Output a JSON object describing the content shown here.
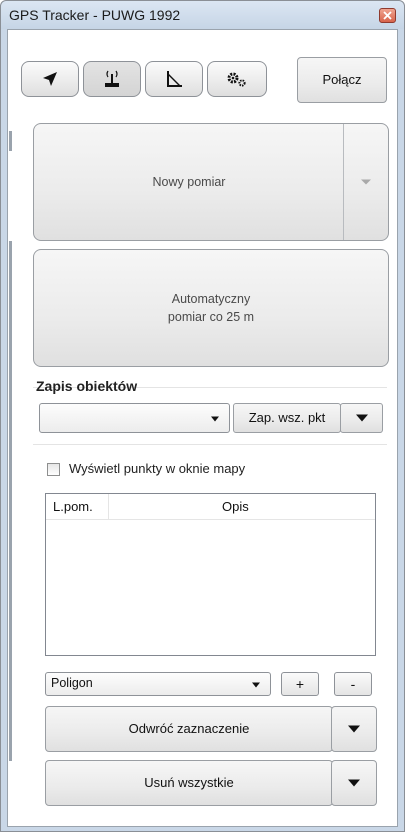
{
  "window": {
    "title": "GPS Tracker - PUWG 1992"
  },
  "toolbar": {
    "tools": [
      {
        "icon": "navigation-arrow-icon",
        "active": false
      },
      {
        "icon": "gps-antenna-icon",
        "active": true
      },
      {
        "icon": "measure-angle-icon",
        "active": false
      },
      {
        "icon": "settings-gears-icon",
        "active": false
      }
    ],
    "connect_label": "Połącz"
  },
  "measurement": {
    "new_label": "Nowy pomiar",
    "auto_label_line1": "Automatyczny",
    "auto_label_line2": "pomiar co 25 m"
  },
  "save_objects": {
    "group_label": "Zapis obiektów",
    "combo_value": "",
    "save_all_label": "Zap. wsz. pkt"
  },
  "points": {
    "show_on_map_label": "Wyświetl punkty w oknie mapy",
    "show_on_map_checked": false,
    "columns": [
      "L.pom.",
      "Opis"
    ],
    "rows": []
  },
  "geometry": {
    "type_value": "Poligon",
    "add_label": "+",
    "remove_label": "-"
  },
  "actions": {
    "invert_label": "Odwróć zaznaczenie",
    "delete_all_label": "Usuń wszystkie"
  },
  "colors": {
    "window_frame": "#c9d7e7",
    "close_button": "#d7634b"
  }
}
